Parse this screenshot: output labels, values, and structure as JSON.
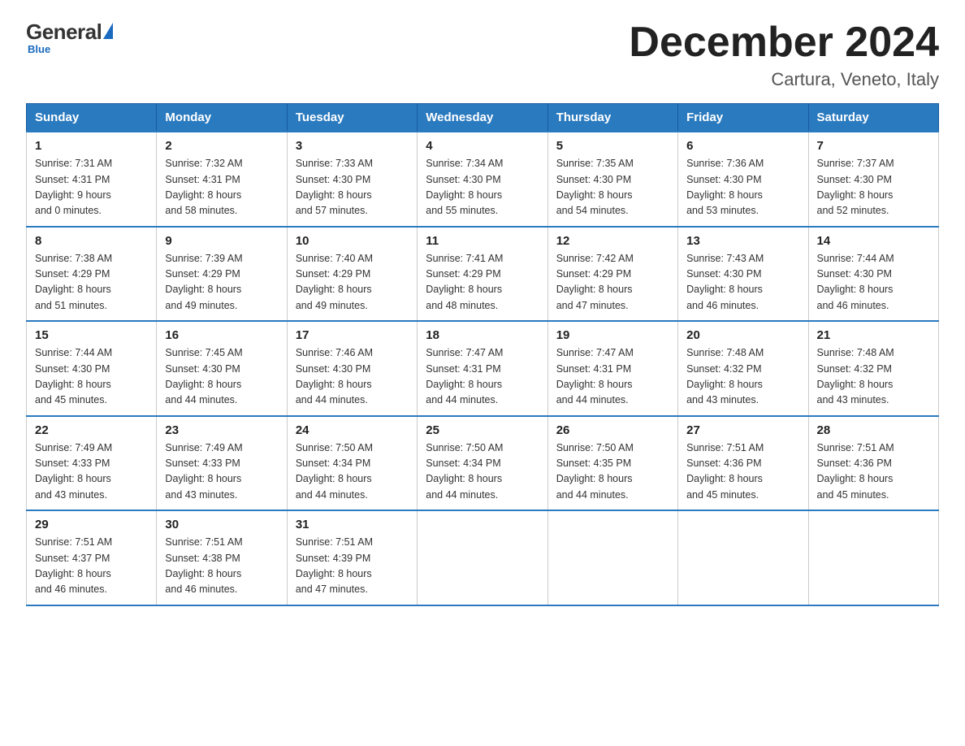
{
  "logo": {
    "general": "General",
    "blue": "Blue",
    "subtitle": "Blue"
  },
  "header": {
    "month_title": "December 2024",
    "location": "Cartura, Veneto, Italy"
  },
  "weekdays": [
    "Sunday",
    "Monday",
    "Tuesday",
    "Wednesday",
    "Thursday",
    "Friday",
    "Saturday"
  ],
  "weeks": [
    [
      {
        "num": "1",
        "sunrise": "7:31 AM",
        "sunset": "4:31 PM",
        "daylight": "9 hours and 0 minutes."
      },
      {
        "num": "2",
        "sunrise": "7:32 AM",
        "sunset": "4:31 PM",
        "daylight": "8 hours and 58 minutes."
      },
      {
        "num": "3",
        "sunrise": "7:33 AM",
        "sunset": "4:30 PM",
        "daylight": "8 hours and 57 minutes."
      },
      {
        "num": "4",
        "sunrise": "7:34 AM",
        "sunset": "4:30 PM",
        "daylight": "8 hours and 55 minutes."
      },
      {
        "num": "5",
        "sunrise": "7:35 AM",
        "sunset": "4:30 PM",
        "daylight": "8 hours and 54 minutes."
      },
      {
        "num": "6",
        "sunrise": "7:36 AM",
        "sunset": "4:30 PM",
        "daylight": "8 hours and 53 minutes."
      },
      {
        "num": "7",
        "sunrise": "7:37 AM",
        "sunset": "4:30 PM",
        "daylight": "8 hours and 52 minutes."
      }
    ],
    [
      {
        "num": "8",
        "sunrise": "7:38 AM",
        "sunset": "4:29 PM",
        "daylight": "8 hours and 51 minutes."
      },
      {
        "num": "9",
        "sunrise": "7:39 AM",
        "sunset": "4:29 PM",
        "daylight": "8 hours and 49 minutes."
      },
      {
        "num": "10",
        "sunrise": "7:40 AM",
        "sunset": "4:29 PM",
        "daylight": "8 hours and 49 minutes."
      },
      {
        "num": "11",
        "sunrise": "7:41 AM",
        "sunset": "4:29 PM",
        "daylight": "8 hours and 48 minutes."
      },
      {
        "num": "12",
        "sunrise": "7:42 AM",
        "sunset": "4:29 PM",
        "daylight": "8 hours and 47 minutes."
      },
      {
        "num": "13",
        "sunrise": "7:43 AM",
        "sunset": "4:30 PM",
        "daylight": "8 hours and 46 minutes."
      },
      {
        "num": "14",
        "sunrise": "7:44 AM",
        "sunset": "4:30 PM",
        "daylight": "8 hours and 46 minutes."
      }
    ],
    [
      {
        "num": "15",
        "sunrise": "7:44 AM",
        "sunset": "4:30 PM",
        "daylight": "8 hours and 45 minutes."
      },
      {
        "num": "16",
        "sunrise": "7:45 AM",
        "sunset": "4:30 PM",
        "daylight": "8 hours and 44 minutes."
      },
      {
        "num": "17",
        "sunrise": "7:46 AM",
        "sunset": "4:30 PM",
        "daylight": "8 hours and 44 minutes."
      },
      {
        "num": "18",
        "sunrise": "7:47 AM",
        "sunset": "4:31 PM",
        "daylight": "8 hours and 44 minutes."
      },
      {
        "num": "19",
        "sunrise": "7:47 AM",
        "sunset": "4:31 PM",
        "daylight": "8 hours and 44 minutes."
      },
      {
        "num": "20",
        "sunrise": "7:48 AM",
        "sunset": "4:32 PM",
        "daylight": "8 hours and 43 minutes."
      },
      {
        "num": "21",
        "sunrise": "7:48 AM",
        "sunset": "4:32 PM",
        "daylight": "8 hours and 43 minutes."
      }
    ],
    [
      {
        "num": "22",
        "sunrise": "7:49 AM",
        "sunset": "4:33 PM",
        "daylight": "8 hours and 43 minutes."
      },
      {
        "num": "23",
        "sunrise": "7:49 AM",
        "sunset": "4:33 PM",
        "daylight": "8 hours and 43 minutes."
      },
      {
        "num": "24",
        "sunrise": "7:50 AM",
        "sunset": "4:34 PM",
        "daylight": "8 hours and 44 minutes."
      },
      {
        "num": "25",
        "sunrise": "7:50 AM",
        "sunset": "4:34 PM",
        "daylight": "8 hours and 44 minutes."
      },
      {
        "num": "26",
        "sunrise": "7:50 AM",
        "sunset": "4:35 PM",
        "daylight": "8 hours and 44 minutes."
      },
      {
        "num": "27",
        "sunrise": "7:51 AM",
        "sunset": "4:36 PM",
        "daylight": "8 hours and 45 minutes."
      },
      {
        "num": "28",
        "sunrise": "7:51 AM",
        "sunset": "4:36 PM",
        "daylight": "8 hours and 45 minutes."
      }
    ],
    [
      {
        "num": "29",
        "sunrise": "7:51 AM",
        "sunset": "4:37 PM",
        "daylight": "8 hours and 46 minutes."
      },
      {
        "num": "30",
        "sunrise": "7:51 AM",
        "sunset": "4:38 PM",
        "daylight": "8 hours and 46 minutes."
      },
      {
        "num": "31",
        "sunrise": "7:51 AM",
        "sunset": "4:39 PM",
        "daylight": "8 hours and 47 minutes."
      },
      null,
      null,
      null,
      null
    ]
  ]
}
